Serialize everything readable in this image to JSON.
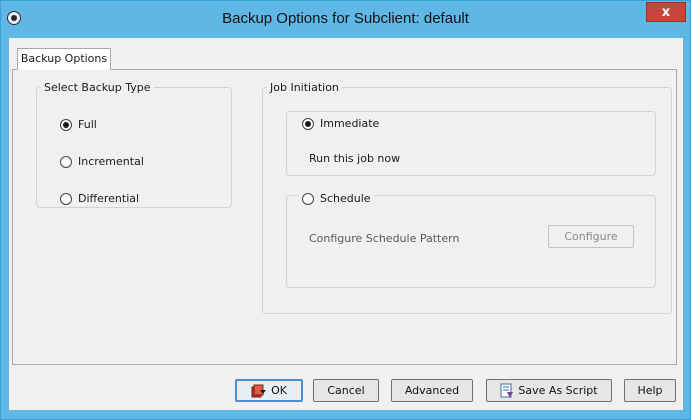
{
  "window": {
    "title": "Backup Options for Subclient: default",
    "close_label": "x"
  },
  "tabs": [
    {
      "label": "Backup Options"
    }
  ],
  "backup_type": {
    "legend": "Select Backup Type",
    "options": [
      {
        "label": "Full",
        "checked": true
      },
      {
        "label": "Incremental",
        "checked": false
      },
      {
        "label": "Differential",
        "checked": false
      }
    ]
  },
  "job_initiation": {
    "legend": "Job Initiation",
    "immediate": {
      "label": "Immediate",
      "checked": true,
      "description": "Run this job now"
    },
    "schedule": {
      "label": "Schedule",
      "checked": false,
      "description": "Configure Schedule Pattern",
      "configure_label": "Configure"
    }
  },
  "buttons": {
    "ok": "OK",
    "cancel": "Cancel",
    "advanced": "Advanced",
    "save_as_script": "Save As Script",
    "help": "Help"
  },
  "colors": {
    "title_bar": "#5fb7e6",
    "close_button": "#c7463c",
    "panel": "#f0f0f0"
  }
}
